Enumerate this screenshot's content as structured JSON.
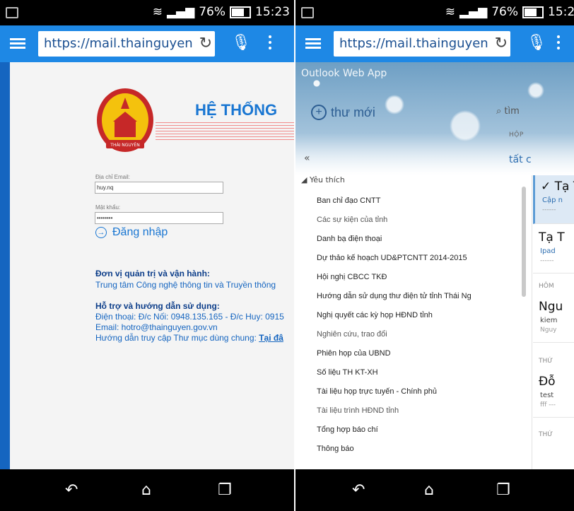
{
  "status_bar": {
    "battery": "76%",
    "time": "15:23"
  },
  "browser": {
    "left_url": "https://mail.thainguyen",
    "right_url": "https://mail.thainguyen"
  },
  "login": {
    "emblem_text": "THÁI NGUYÊN",
    "system_title": "HỆ THỐNG",
    "email_label": "Địa chỉ Email:",
    "email_value": "huy.nq",
    "password_label": "Mật khẩu:",
    "password_value": "••••••••",
    "login_button": "Đăng nhập",
    "operator_heading": "Đơn vị quản trị và vận hành:",
    "operator_value": "Trung tâm Công nghệ thông tin và Truyền thông",
    "support_heading": "Hỗ trợ và hướng dẫn sử dụng:",
    "support_phone": "Điện thoại: Đ/c Nối: 0948.135.165 - Đ/c Huy: 0915",
    "support_email": "Email: hotro@thainguyen.gov.vn",
    "support_guide": "Hướng dẫn truy cập Thư mục dùng chung:",
    "support_link": "Tại đâ"
  },
  "owa": {
    "brand": "Outlook Web App",
    "new_mail": "thư mới",
    "search_placeholder": "tìm",
    "inbox_label": "HỘP",
    "all_link": "tất c",
    "collapse": "«",
    "favorites_header": "Yêu thích",
    "folders": [
      "Ban chỉ đạo CNTT",
      "Các sự kiện của tỉnh",
      "Danh bạ điện thoại",
      "Dự thảo kế hoạch UD&PTCNTT 2014-2015",
      "Hội nghị CBCC TKĐ",
      "Hướng dẫn sử dụng thư điện tử tỉnh Thái Ng",
      "Nghị quyết các kỳ họp HĐND tỉnh",
      "Nghiên cứu, trao đổi",
      "Phiên họp của UBND",
      "Số liệu TH KT-XH",
      "Tài liệu họp trực tuyến - Chính phủ",
      "Tài liệu trình HĐND tỉnh",
      "Tổng hợp báo chí",
      "Thông báo"
    ],
    "mails": [
      {
        "sender": "Tạ T",
        "subject": "Cập n",
        "preview": "------"
      },
      {
        "sender": "Tạ T",
        "subject": "Ipad",
        "preview": "------"
      },
      {
        "sender": "Ngu",
        "subject": "kiem",
        "preview": "Nguy"
      },
      {
        "sender": "Đỗ",
        "subject": "test",
        "preview": "fff ---"
      }
    ],
    "groups": [
      "HÔM",
      "THỨ",
      "THỨ"
    ]
  }
}
